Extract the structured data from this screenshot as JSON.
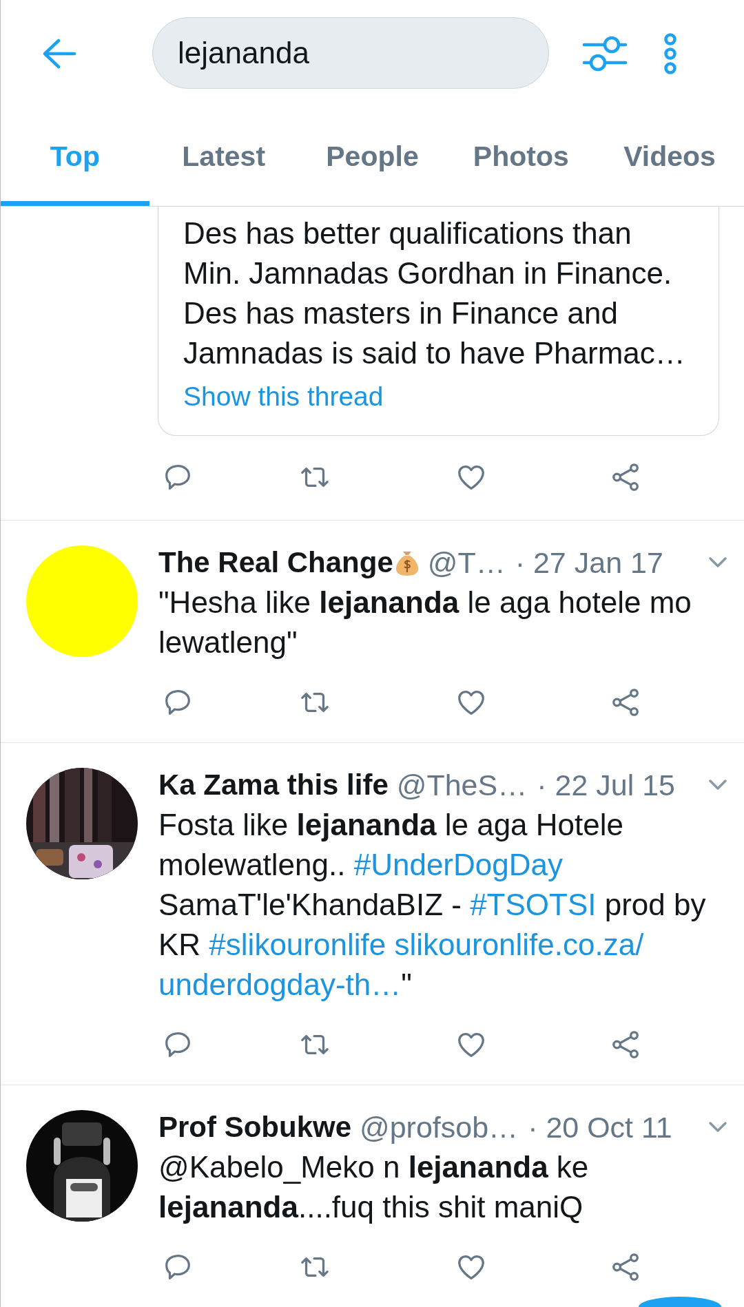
{
  "header": {
    "search": {
      "value": "lejananda"
    }
  },
  "tabs": [
    {
      "label": "Top",
      "selected": true
    },
    {
      "label": "Latest",
      "selected": false
    },
    {
      "label": "People",
      "selected": false
    },
    {
      "label": "Photos",
      "selected": false
    },
    {
      "label": "Videos",
      "selected": false
    }
  ],
  "partial_tweet": {
    "quoted_text": "Des has better qualifications than\nMin. Jamnadas Gordhan in Finance.\nDes has masters in Finance and\nJamnadas is said to have Pharmac…",
    "show_thread": "Show this thread"
  },
  "tweets": [
    {
      "avatar": {
        "kind": "plain",
        "color": "#ffff00"
      },
      "name": "The Real Change",
      "money_bag_emoji": true,
      "handle": "@T…",
      "date": "· 27 Jan 17",
      "body": [
        {
          "kind": "text",
          "text": "\"Hesha like **lejananda** le aga hotele mo\nlewatleng\""
        }
      ]
    },
    {
      "name": "Ka Zama this life",
      "handle": "@TheS…",
      "date": "· 22 Jul 15",
      "body": [
        {
          "kind": "text",
          "text": "Fosta like **lejananda** le aga Hotele\nmolewatleng.. "
        },
        {
          "kind": "link",
          "text": "#UnderDogDay"
        },
        {
          "kind": "text",
          "text": "\nSamaT'le'KhandaBIZ - "
        },
        {
          "kind": "link",
          "text": "#TSOTSI"
        },
        {
          "kind": "text",
          "text": " prod by\nKR "
        },
        {
          "kind": "link",
          "text": "#slikouronlife"
        },
        {
          "kind": "link",
          "text": "slikouronlife.co.za/"
        },
        {
          "kind": "link",
          "text": "underdogday-th…",
          "new_line": true
        },
        {
          "kind": "text",
          "text": "\""
        }
      ]
    },
    {
      "name": "Prof Sobukwe",
      "handle": "@profsob…",
      "date": "· 20 Oct 11",
      "body": [
        {
          "kind": "text",
          "text": "@Kabelo_Meko n **lejananda** ke\n**lejananda**....fuq this shit maniQ"
        }
      ]
    }
  ]
}
